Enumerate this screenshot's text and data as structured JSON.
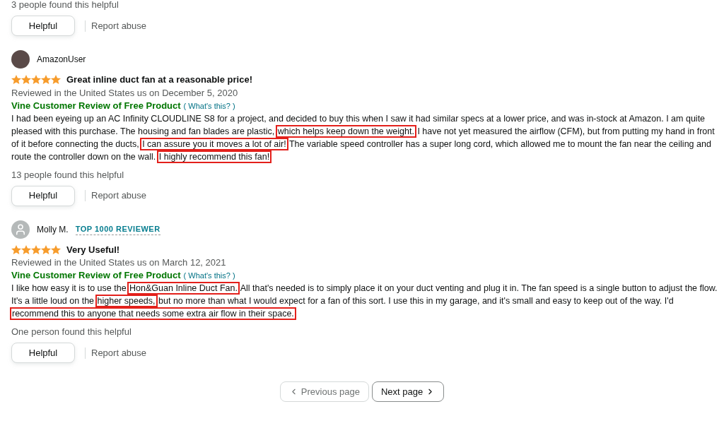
{
  "previous_review": {
    "helpful_count": "3 people found this helpful",
    "helpful_button": "Helpful",
    "report_link": "Report abuse"
  },
  "reviews": [
    {
      "author": "AmazonUser",
      "avatar": {
        "kind": "photo"
      },
      "stars": 5,
      "title": "Great inline duct fan at a reasonable price!",
      "reviewed": "Reviewed in the United States us on December 5, 2020",
      "vine_label": "Vine Customer Review of Free Product",
      "whats_this": "( What's this? )",
      "body": [
        {
          "text": "I had been eyeing up an AC Infinity CLOUDLINE S8 for a project, and decided to buy this when I saw it had similar specs at a lower price, and was in-stock at Amazon. I am quite pleased with this purchase. The housing and fan blades are plastic,",
          "highlighted": false
        },
        {
          "text": "which helps keep down the weight.",
          "highlighted": true
        },
        {
          "text": "I have not yet measured the airflow (CFM), but from putting my hand in front of it before connecting the ducts,",
          "highlighted": false
        },
        {
          "text": "I can assure you it moves a lot of air!",
          "highlighted": true
        },
        {
          "text": "The variable speed controller has a super long cord, which allowed me to mount the fan near the ceiling and route the controller down on the wall.",
          "highlighted": false
        },
        {
          "text": "I highly recommend this fan!",
          "highlighted": true
        }
      ],
      "helpful_count": "13 people found this helpful",
      "helpful_button": "Helpful",
      "report_link": "Report abuse"
    },
    {
      "author": "Molly M.",
      "avatar": {
        "kind": "default"
      },
      "badge": "TOP 1000 REVIEWER",
      "stars": 5,
      "title": "Very Useful!",
      "reviewed": "Reviewed in the United States us on March 12, 2021",
      "vine_label": "Vine Customer Review of Free Product",
      "whats_this": "( What's this? )",
      "body": [
        {
          "text": "I like how easy it is to use the",
          "highlighted": false
        },
        {
          "text": "Hon&Guan Inline Duct Fan.",
          "highlighted": true
        },
        {
          "text": "All that's needed is to simply place it on your duct venting and plug it in. The fan speed is a single button to adjust the flow. It's a little loud on the",
          "highlighted": false
        },
        {
          "text": "higher speeds,",
          "highlighted": true
        },
        {
          "text": "but no more than what I would expect for a fan of this sort. I use this in my garage, and it's small and easy to keep out of the way. I'd",
          "highlighted": false
        },
        {
          "text": "recommend this to anyone that needs some extra air flow in their space.",
          "highlighted": true
        }
      ],
      "helpful_count": "One person found this helpful",
      "helpful_button": "Helpful",
      "report_link": "Report abuse"
    }
  ],
  "pagination": [
    {
      "kind": "prev",
      "label": "Previous page",
      "disabled": true
    },
    {
      "kind": "next",
      "label": "Next page",
      "disabled": false
    }
  ]
}
